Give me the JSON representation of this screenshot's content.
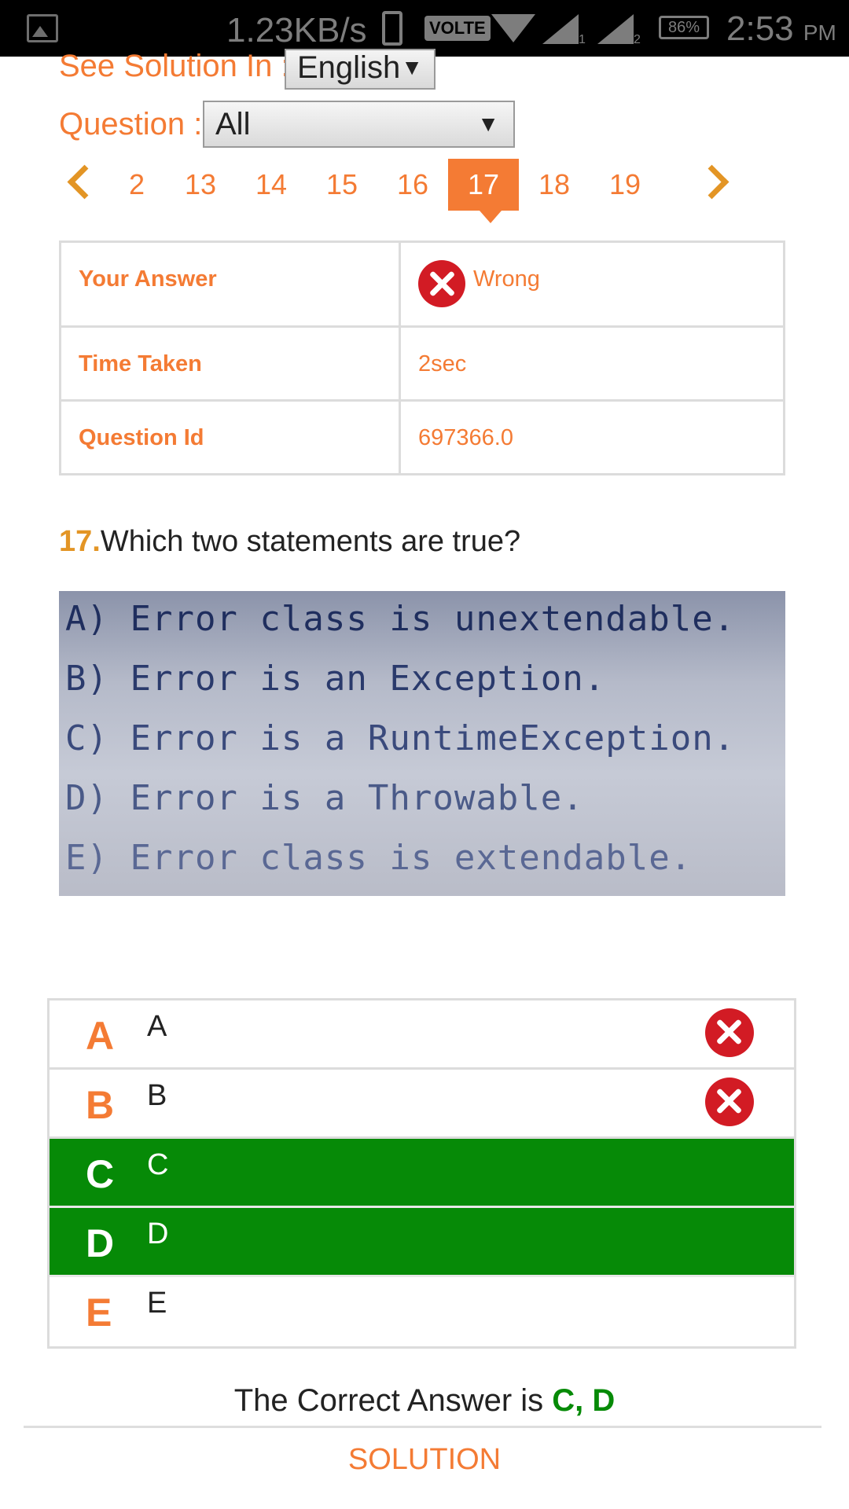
{
  "status_bar": {
    "speed": "1.23KB/s",
    "volte": "VOLTE",
    "sim1": "1",
    "sim2": "2",
    "battery": "86%",
    "time": "2:53",
    "ampm": "PM"
  },
  "see_solution": {
    "label": "See Solution In :",
    "value": "English"
  },
  "question_filter": {
    "label": "Question :",
    "value": "All"
  },
  "pager": {
    "pages": [
      "2",
      "13",
      "14",
      "15",
      "16",
      "17",
      "18",
      "19"
    ],
    "active": "17"
  },
  "info": {
    "rows": [
      {
        "key": "Your Answer",
        "value": "Wrong"
      },
      {
        "key": "Time Taken",
        "value": "2sec"
      },
      {
        "key": "Question Id",
        "value": "697366.0"
      }
    ]
  },
  "question": {
    "number": "17.",
    "text": "Which two statements are true?"
  },
  "question_image": {
    "lines": [
      "A) Error class is unextendable.",
      "B) Error is an Exception.",
      "C) Error is a RuntimeException.",
      "D) Error is a Throwable.",
      "E) Error class is extendable."
    ]
  },
  "options": [
    {
      "letter": "A",
      "text": "A",
      "state": "wrong"
    },
    {
      "letter": "B",
      "text": "B",
      "state": "wrong"
    },
    {
      "letter": "C",
      "text": "C",
      "state": "correct"
    },
    {
      "letter": "D",
      "text": "D",
      "state": "correct"
    },
    {
      "letter": "E",
      "text": "E",
      "state": "none"
    }
  ],
  "correct_answer": {
    "label": "The Correct Answer is",
    "value": "C, D"
  },
  "solution_button": "SOLUTION",
  "colors": {
    "accent": "#f47b34",
    "correct": "#068a07",
    "wrong": "#d21b24",
    "gold": "#e39525"
  }
}
